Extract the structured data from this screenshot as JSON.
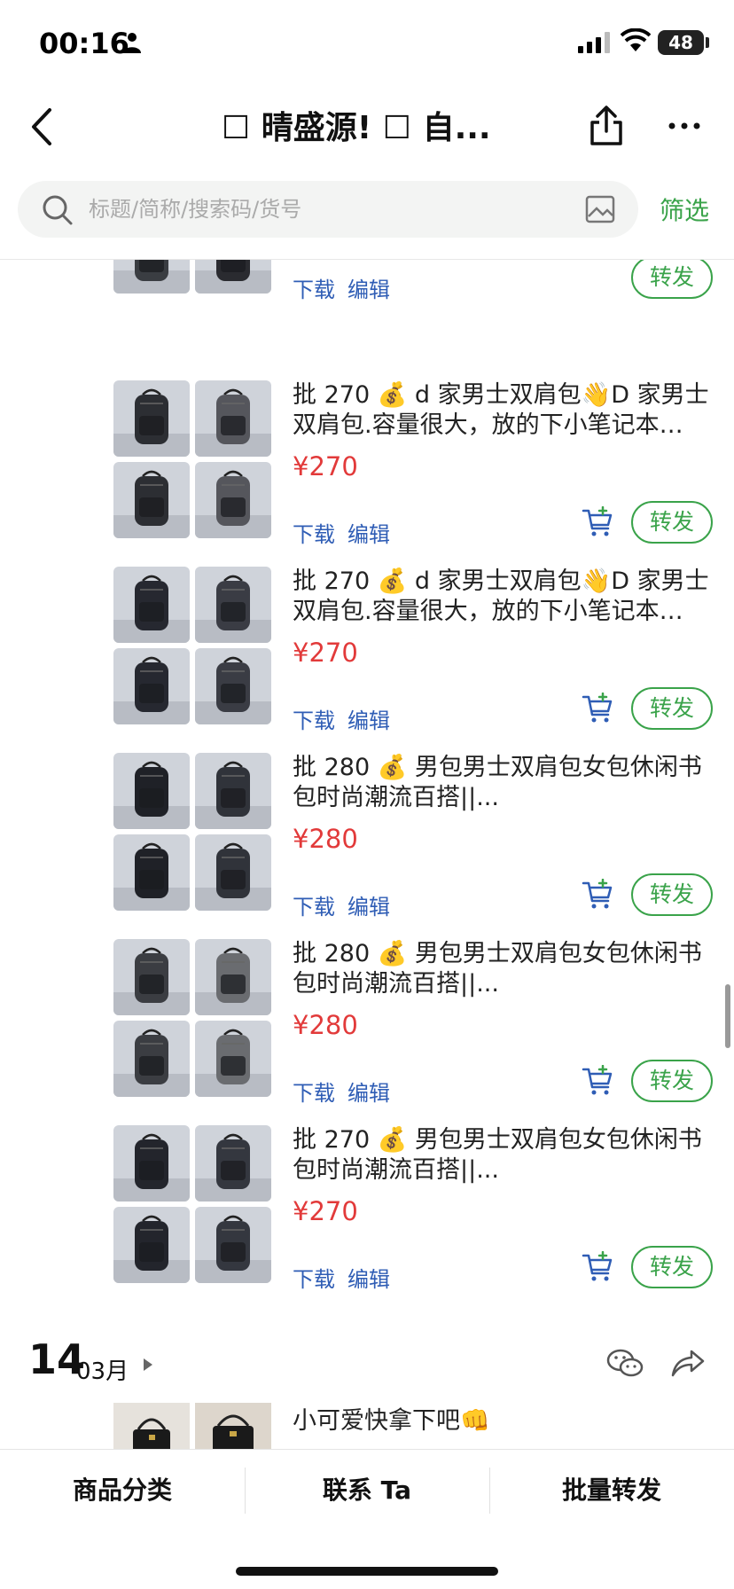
{
  "status_bar": {
    "time": "00:16",
    "battery": "48"
  },
  "nav": {
    "title": "☐ 晴盛源! ☐ 自..."
  },
  "search": {
    "placeholder": "标题/简称/搜索码/货号",
    "filter_label": "筛选"
  },
  "actions": {
    "download": "下载",
    "edit": "编辑",
    "forward": "转发"
  },
  "colors": {
    "accent_green": "#3aa34a",
    "price_red": "#e23a3a",
    "link_blue": "#2f5db5"
  },
  "products": [
    {
      "title": "",
      "price": "",
      "has_cart": false
    },
    {
      "title": "批 270 💰 d 家男士双肩包👋D 家男士双肩包.容量很大，放的下小笔记本…",
      "price": "¥270",
      "has_cart": true
    },
    {
      "title": "批 270 💰 d 家男士双肩包👋D 家男士双肩包.容量很大，放的下小笔记本…",
      "price": "¥270",
      "has_cart": true
    },
    {
      "title": "批 280 💰 男包男士双肩包女包休闲书包时尚潮流百搭||...",
      "price": "¥280",
      "has_cart": true
    },
    {
      "title": "批 280 💰 男包男士双肩包女包休闲书包时尚潮流百搭||...",
      "price": "¥280",
      "has_cart": true
    },
    {
      "title": "批 270 💰 男包男士双肩包女包休闲书包时尚潮流百搭||...",
      "price": "¥270",
      "has_cart": true
    }
  ],
  "date_group": {
    "day": "14",
    "month": "03月"
  },
  "post": {
    "text": "小可爱快拿下吧👊"
  },
  "bottom_tabs": [
    "商品分类",
    "联系 Ta",
    "批量转发"
  ]
}
